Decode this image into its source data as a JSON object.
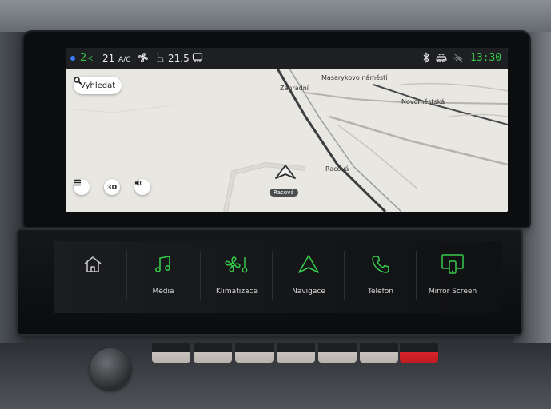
{
  "status_bar": {
    "fan_level": "2",
    "temp_left": "21",
    "ac_label": "A/C",
    "temp_right": "21.5",
    "clock": "13:30"
  },
  "map": {
    "search_label": "Vyhledat",
    "labels": {
      "zahradni": "Zahradní",
      "masarykovo": "Masarykovo náměstí",
      "novomestska": "Novoměstská",
      "racova": "Racová"
    },
    "current_street": "Racová",
    "btn_3d": "3D"
  },
  "shortcuts": [
    {
      "label": "",
      "icon": "home-icon"
    },
    {
      "label": "Média",
      "icon": "music-note-icon"
    },
    {
      "label": "Klimatizace",
      "icon": "fan-thermometer-icon"
    },
    {
      "label": "Navigace",
      "icon": "navigation-arrow-icon"
    },
    {
      "label": "Telefon",
      "icon": "phone-icon"
    },
    {
      "label": "Mirror Screen",
      "icon": "mirror-screen-icon"
    }
  ],
  "colors": {
    "accent_green": "#35c94a",
    "status_bar_bg": "#1d1f22",
    "map_bg": "#e9e7e2",
    "hazard_red": "#d9242b"
  }
}
